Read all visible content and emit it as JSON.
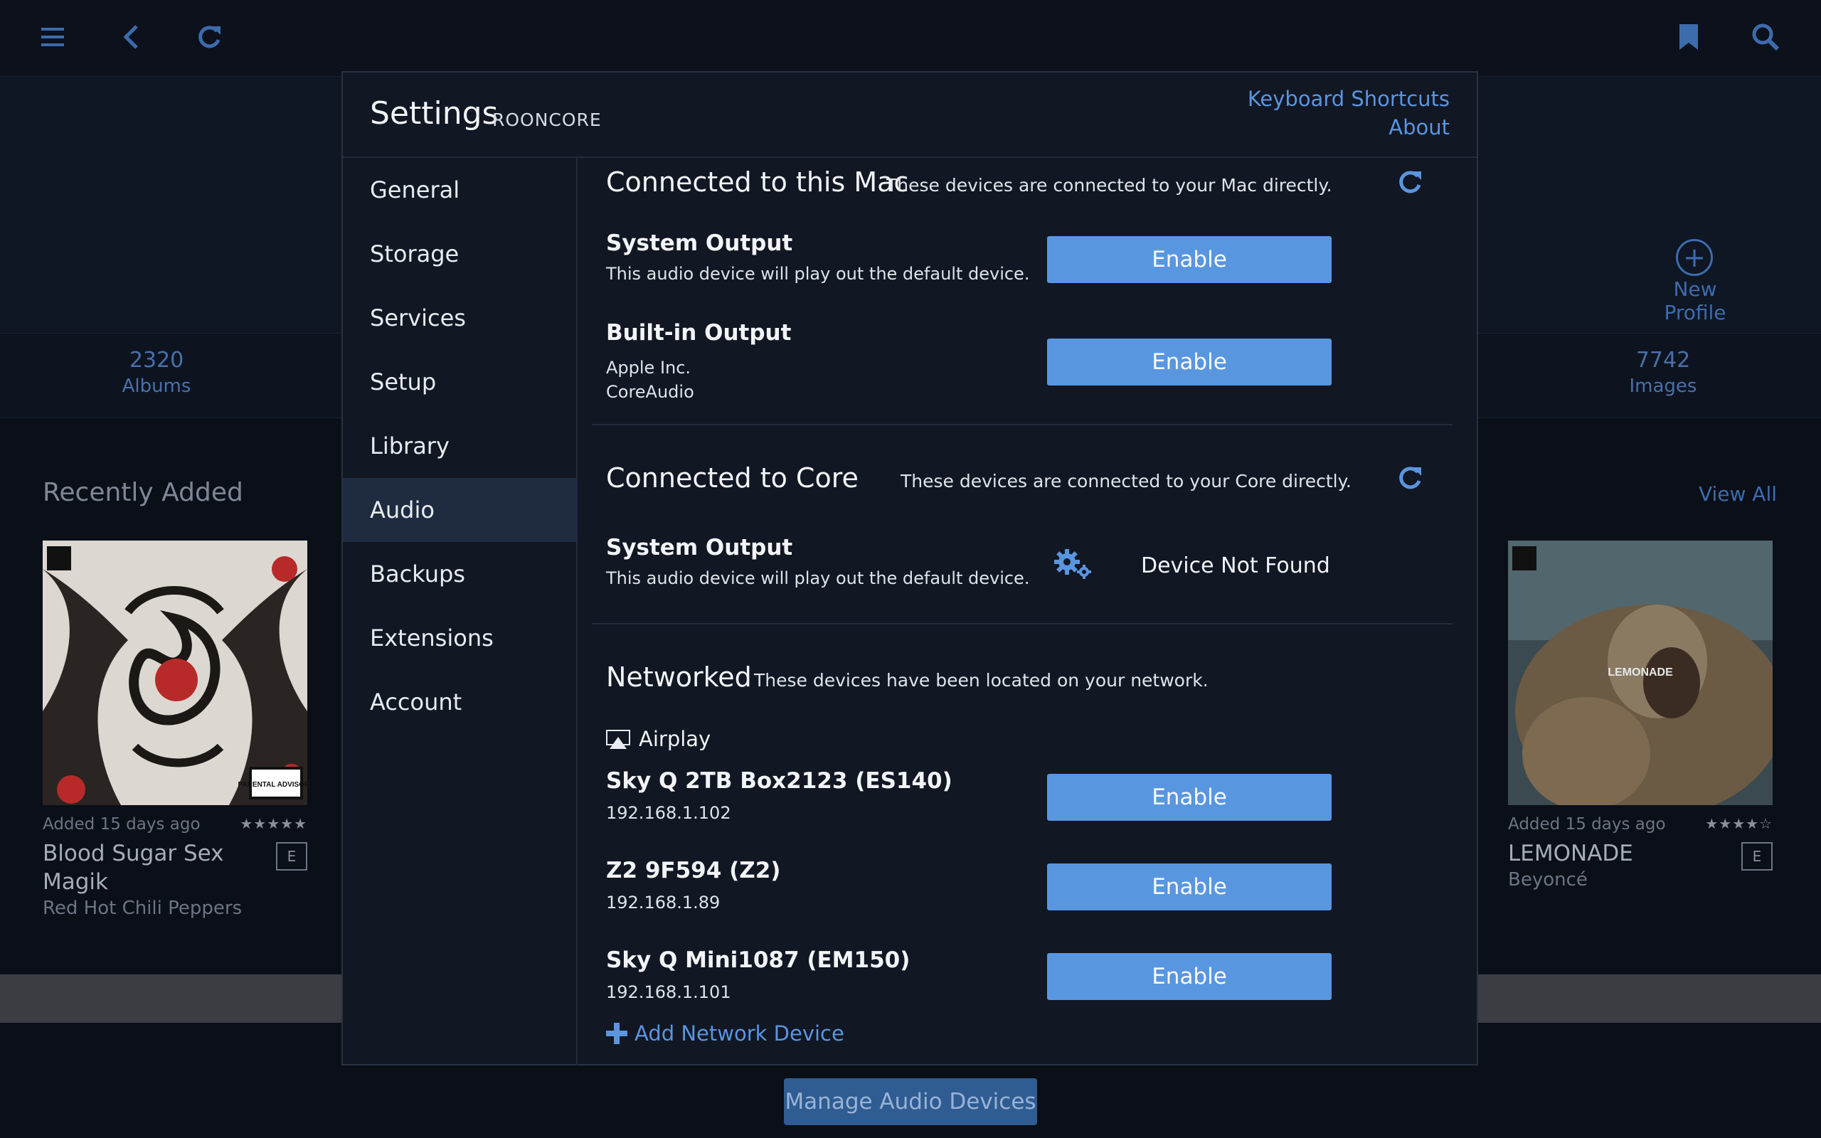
{
  "topbar": {
    "icons": [
      "hamburger-icon",
      "back-icon",
      "refresh-icon",
      "bookmark-icon",
      "search-icon"
    ]
  },
  "hero": {
    "new_profile": "New Profile"
  },
  "stats": [
    {
      "number": "2320",
      "label": "Albums"
    },
    {
      "number": "7742",
      "label": "Images"
    }
  ],
  "recent": {
    "title": "Recently Added",
    "view_all": "View All",
    "albums": [
      {
        "added": "Added 15 days ago",
        "title": "Blood Sugar Sex Magik",
        "artist": "Red Hot Chili Peppers",
        "badge": "E",
        "rating": 5
      },
      {
        "added": "Added 15 days ago",
        "title": "LEMONADE",
        "artist": "Beyoncé",
        "badge": "E",
        "rating": 3.5
      }
    ],
    "cover_texts": {
      "rhcp_advisory": "PARENTAL ADVISORY",
      "lemonade": "LEMONADE"
    }
  },
  "bottom": {
    "manage_button": "Manage Audio Devices"
  },
  "modal": {
    "title": "Settings",
    "subtitle": "ROONCORE",
    "links": [
      "Keyboard Shortcuts",
      "About"
    ],
    "nav": [
      "General",
      "Storage",
      "Services",
      "Setup",
      "Library",
      "Audio",
      "Backups",
      "Extensions",
      "Account"
    ],
    "active_nav": "Audio",
    "sections": {
      "mac": {
        "title": "Connected to this Mac",
        "desc": "These devices are connected to your Mac directly.",
        "devices": [
          {
            "name": "System Output",
            "sub1": "This audio device will play out the default device.",
            "button": "Enable"
          },
          {
            "name": "Built-in Output",
            "sub1": "Apple Inc.",
            "sub2": "CoreAudio",
            "button": "Enable"
          }
        ]
      },
      "core": {
        "title": "Connected to Core",
        "desc": "These devices are connected to your Core directly.",
        "devices": [
          {
            "name": "System Output",
            "sub1": "This audio device will play out the default device.",
            "status": "Device Not Found"
          }
        ]
      },
      "network": {
        "title": "Networked",
        "desc": "These devices have been located on your network.",
        "group": "Airplay",
        "devices": [
          {
            "name": "Sky Q 2TB Box2123 (ES140)",
            "ip": "192.168.1.102",
            "button": "Enable"
          },
          {
            "name": "Z2 9F594 (Z2)",
            "ip": "192.168.1.89",
            "button": "Enable"
          },
          {
            "name": "Sky Q Mini1087 (EM150)",
            "ip": "192.168.1.101",
            "button": "Enable"
          }
        ],
        "add_device": "Add Network Device"
      }
    }
  },
  "colors": {
    "accent": "#5996e0",
    "active_nav": "#1e2b40",
    "modal_bg": "#111723"
  }
}
